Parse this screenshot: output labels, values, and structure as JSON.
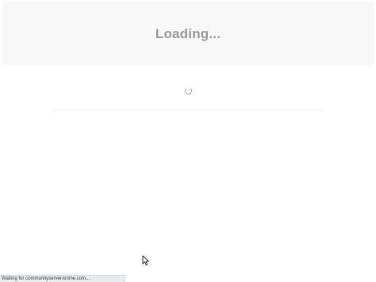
{
  "page": {
    "heading": "Loading..."
  },
  "status_bar": {
    "text": "Waiting for communityserver.knime.com..."
  },
  "icons": {
    "spinner": "loading-spinner-icon",
    "cursor": "mouse-pointer-icon"
  },
  "colors": {
    "heading": "#9b9b9b",
    "header_background": "#f8f8f8",
    "status_bar_background": "#e9ebee"
  }
}
